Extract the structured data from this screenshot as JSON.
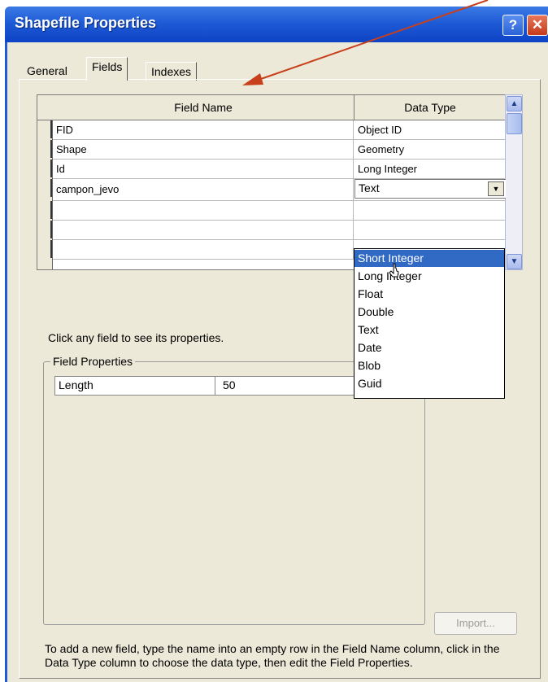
{
  "window": {
    "title": "Shapefile Properties",
    "help_label": "?",
    "close_label": "✕"
  },
  "tabs": [
    {
      "label": "General"
    },
    {
      "label": "Fields"
    },
    {
      "label": "Indexes"
    }
  ],
  "grid": {
    "headers": {
      "field_name": "Field Name",
      "data_type": "Data Type"
    },
    "rows": [
      {
        "field_name": "FID",
        "data_type": "Object ID"
      },
      {
        "field_name": "Shape",
        "data_type": "Geometry"
      },
      {
        "field_name": "Id",
        "data_type": "Long Integer"
      },
      {
        "field_name": "campon_jevo",
        "data_type": "Text"
      },
      {
        "field_name": "",
        "data_type": ""
      },
      {
        "field_name": "",
        "data_type": ""
      },
      {
        "field_name": "",
        "data_type": ""
      }
    ]
  },
  "dropdown": {
    "current": "Text",
    "options": [
      "Short Integer",
      "Long Integer",
      "Float",
      "Double",
      "Text",
      "Date",
      "Blob",
      "Guid"
    ],
    "highlighted": "Short Integer"
  },
  "hint": "Click any field to see its properties.",
  "field_properties": {
    "legend": "Field Properties",
    "rows": [
      {
        "name": "Length",
        "value": "50"
      }
    ]
  },
  "import_label": "Import...",
  "footer": "To add a new field, type the name into an empty row in the Field Name column, click in the Data Type column to choose the data type, then edit the Field Properties.",
  "colors": {
    "title_bar": "#1f5bd6",
    "selection": "#316ac5",
    "annotation_arrow": "#c8401b"
  }
}
